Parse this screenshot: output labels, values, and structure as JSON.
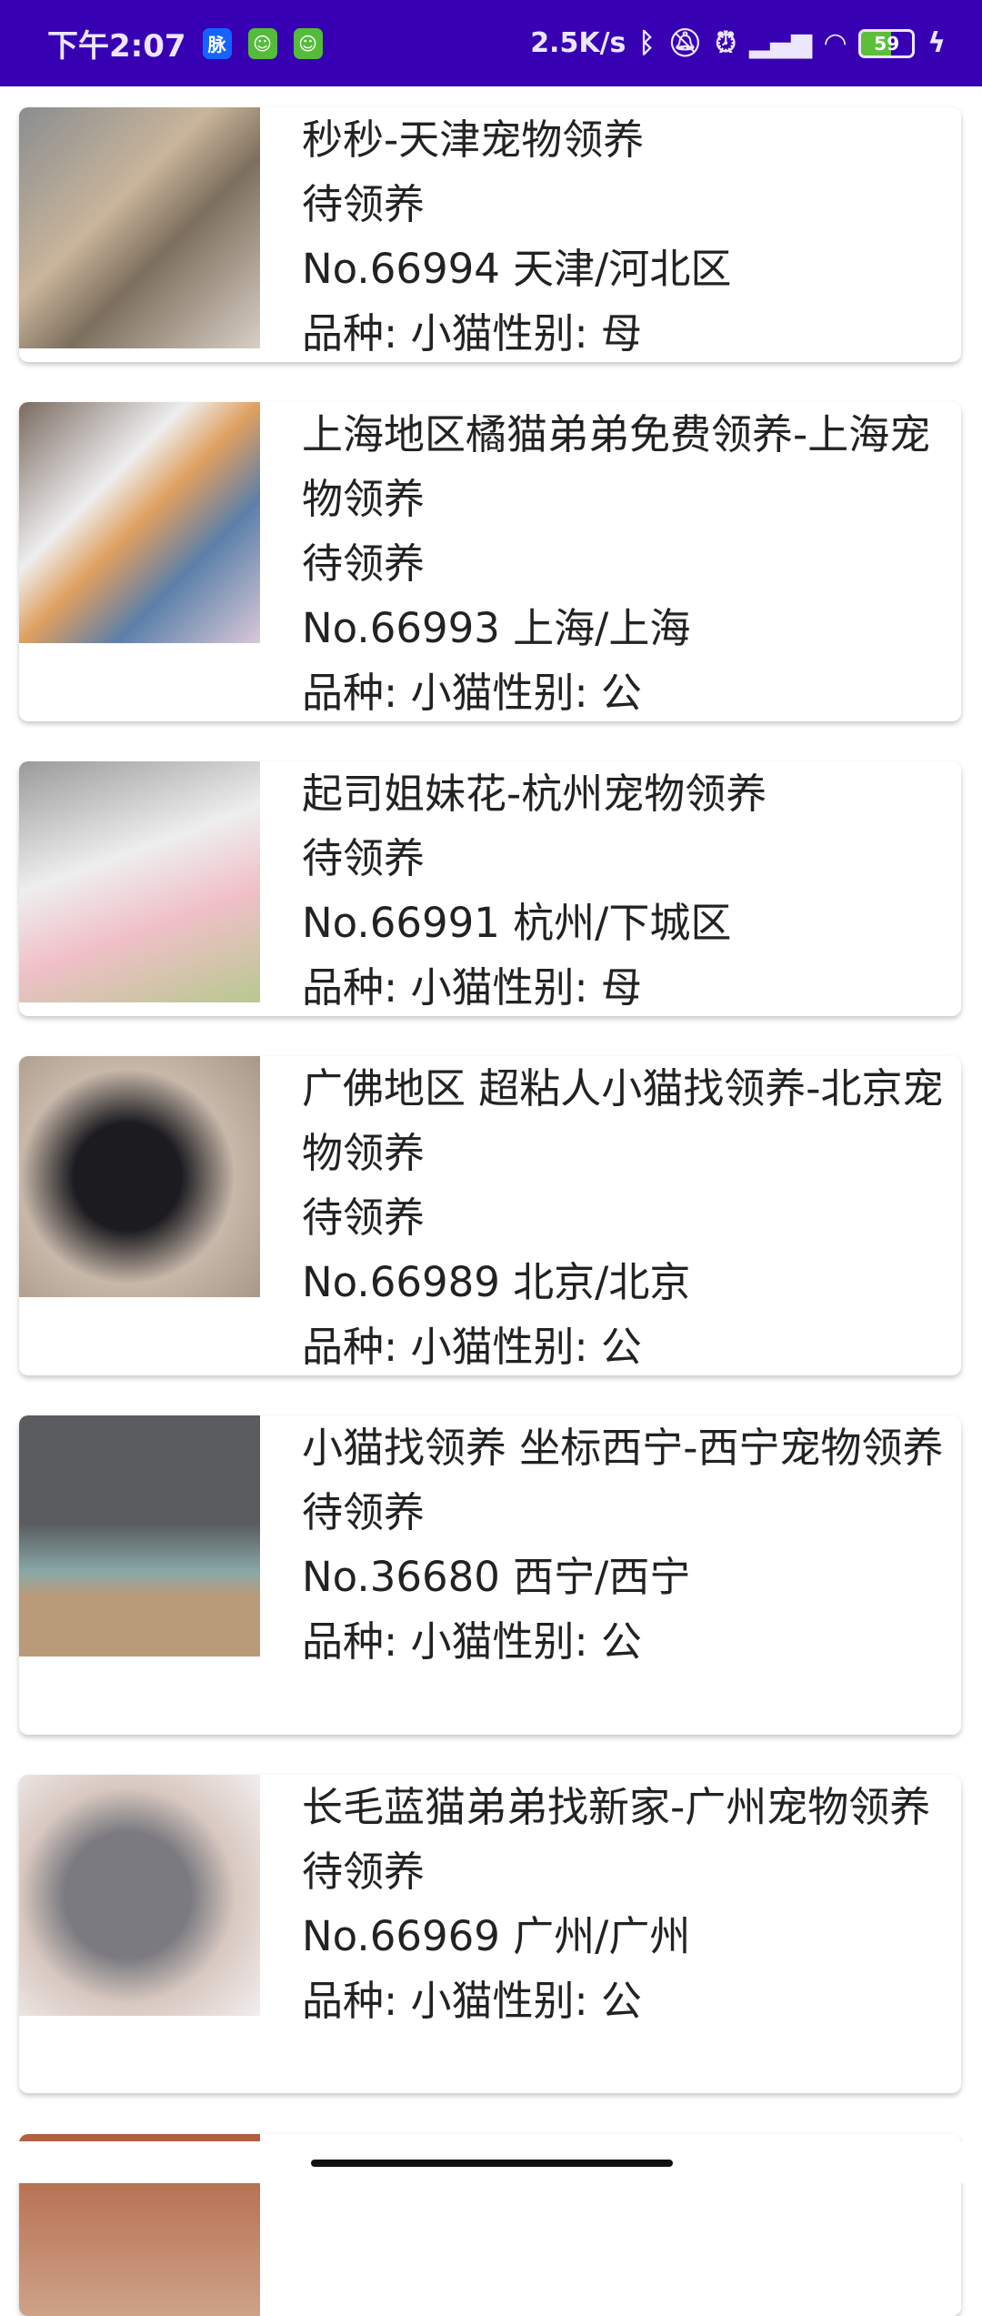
{
  "status_bar": {
    "time": "下午2:07",
    "app_icons": [
      "脉",
      "green-app-icon",
      "green-app-icon"
    ],
    "net_speed": "2.5K/s",
    "icons": [
      "bluetooth-icon",
      "mute-icon",
      "alarm-icon",
      "signal-hd-icon",
      "wifi-icon"
    ],
    "battery": "59",
    "bg": "#3700B3"
  },
  "pets": [
    {
      "title": "秒秒-天津宠物领养",
      "status": "待领养",
      "id_loc": "No.66994 天津/河北区",
      "breed_gender": "品种: 小猫性别: 母"
    },
    {
      "title": "上海地区橘猫弟弟免费领养-上海宠物领养",
      "status": "待领养",
      "id_loc": "No.66993 上海/上海",
      "breed_gender": "品种: 小猫性别: 公"
    },
    {
      "title": "起司姐妹花-杭州宠物领养",
      "status": "待领养",
      "id_loc": "No.66991 杭州/下城区",
      "breed_gender": "品种: 小猫性别: 母"
    },
    {
      "title": "广佛地区 超粘人小猫找领养-北京宠物领养",
      "status": "待领养",
      "id_loc": "No.66989 北京/北京",
      "breed_gender": "品种: 小猫性别: 公"
    },
    {
      "title": "小猫找领养 坐标西宁-西宁宠物领养",
      "status": "待领养",
      "id_loc": "No.36680 西宁/西宁",
      "breed_gender": "品种: 小猫性别: 公"
    },
    {
      "title": "长毛蓝猫弟弟找新家-广州宠物领养",
      "status": "待领养",
      "id_loc": "No.66969 广州/广州",
      "breed_gender": "品种: 小猫性别: 公"
    }
  ]
}
